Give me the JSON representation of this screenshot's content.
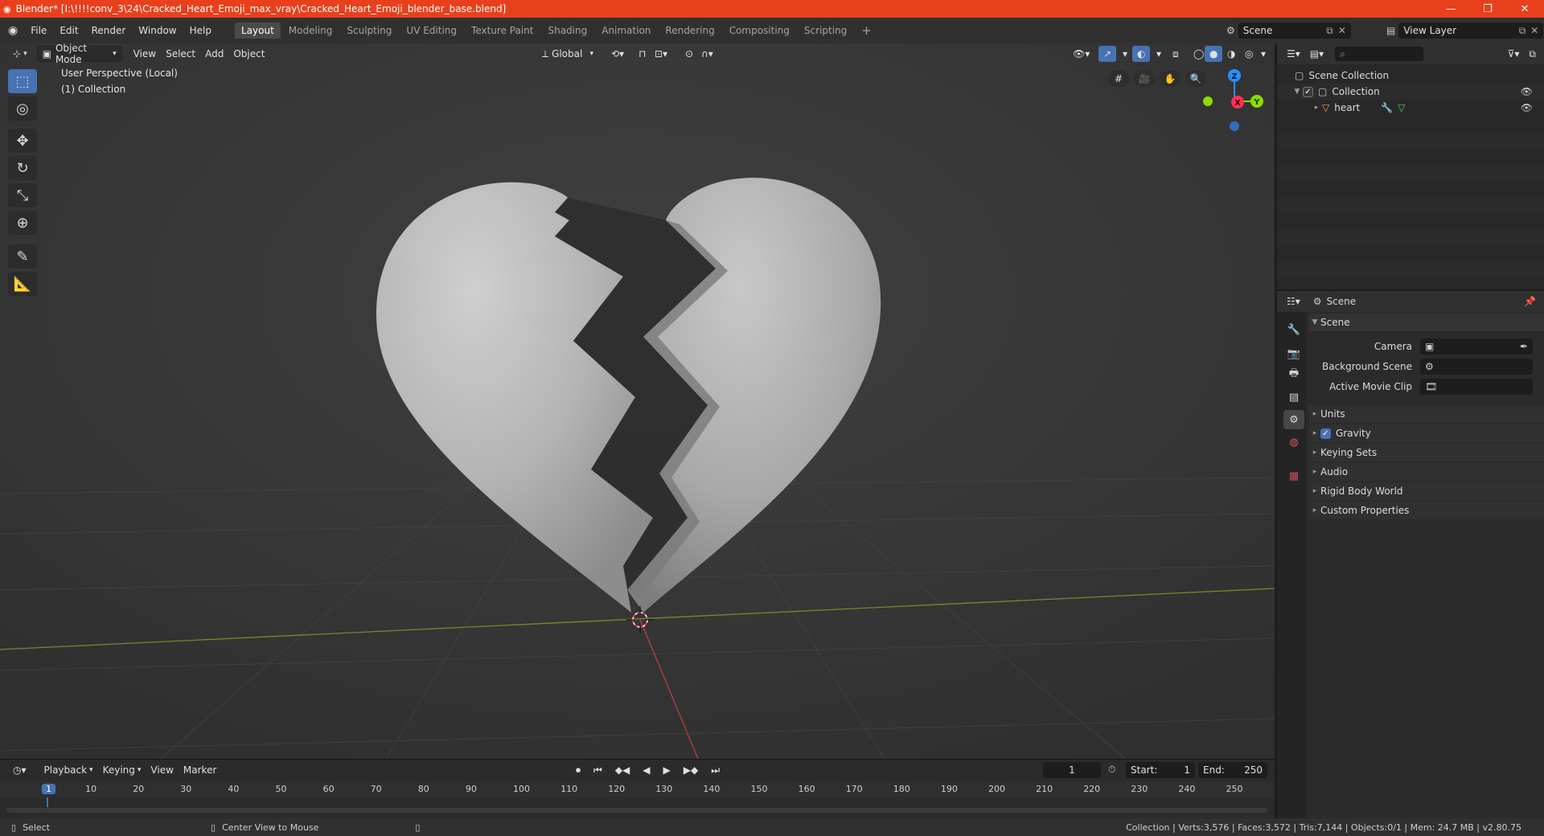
{
  "titlebar": {
    "title": "Blender* [I:\\!!!!conv_3\\24\\Cracked_Heart_Emoji_max_vray\\Cracked_Heart_Emoji_blender_base.blend]",
    "minimize": "—",
    "maximize": "❐",
    "close": "✕"
  },
  "menus": [
    "File",
    "Edit",
    "Render",
    "Window",
    "Help"
  ],
  "workspaces": [
    "Layout",
    "Modeling",
    "Sculpting",
    "UV Editing",
    "Texture Paint",
    "Shading",
    "Animation",
    "Rendering",
    "Compositing",
    "Scripting"
  ],
  "workspace_add": "+",
  "scene_selector": {
    "value": "Scene"
  },
  "view_layer_selector": {
    "value": "View Layer"
  },
  "viewport": {
    "mode": "Object Mode",
    "menu": [
      "View",
      "Select",
      "Add",
      "Object"
    ],
    "orientation": "Global",
    "info_line1": "User Perspective (Local)",
    "info_line2": "(1) Collection",
    "gizmo": {
      "z": "Z",
      "y": "Y",
      "x": "X"
    }
  },
  "outliner": {
    "root": "Scene Collection",
    "collection": "Collection",
    "object": "heart"
  },
  "properties": {
    "header": "Scene",
    "panel_title": "Scene",
    "camera_label": "Camera",
    "background_scene_label": "Background Scene",
    "active_movie_clip_label": "Active Movie Clip",
    "sections": [
      "Units",
      "Gravity",
      "Keying Sets",
      "Audio",
      "Rigid Body World",
      "Custom Properties"
    ],
    "gravity_checked": true
  },
  "timeline": {
    "menu": [
      "Playback",
      "Keying",
      "View",
      "Marker"
    ],
    "current_frame": "1",
    "start_label": "Start:",
    "start_value": "1",
    "end_label": "End:",
    "end_value": "250",
    "ruler_marks": [
      "1",
      "10",
      "20",
      "30",
      "40",
      "50",
      "60",
      "70",
      "80",
      "90",
      "100",
      "110",
      "120",
      "130",
      "140",
      "150",
      "160",
      "170",
      "180",
      "190",
      "200",
      "210",
      "220",
      "230",
      "240",
      "250"
    ]
  },
  "statusbar": {
    "select": "Select",
    "center_view": "Center View to Mouse",
    "stats": "Collection | Verts:3,576 | Faces:3,572 | Tris:7,144 | Objects:0/1 | Mem: 24.7 MB | v2.80.75"
  },
  "colors": {
    "titlebar": "#e8401c",
    "active_blue": "#4772b3",
    "viewport_bg": "#393939",
    "axis_x": "#ff3352",
    "axis_y": "#8bdc00",
    "axis_z": "#2890ff"
  }
}
